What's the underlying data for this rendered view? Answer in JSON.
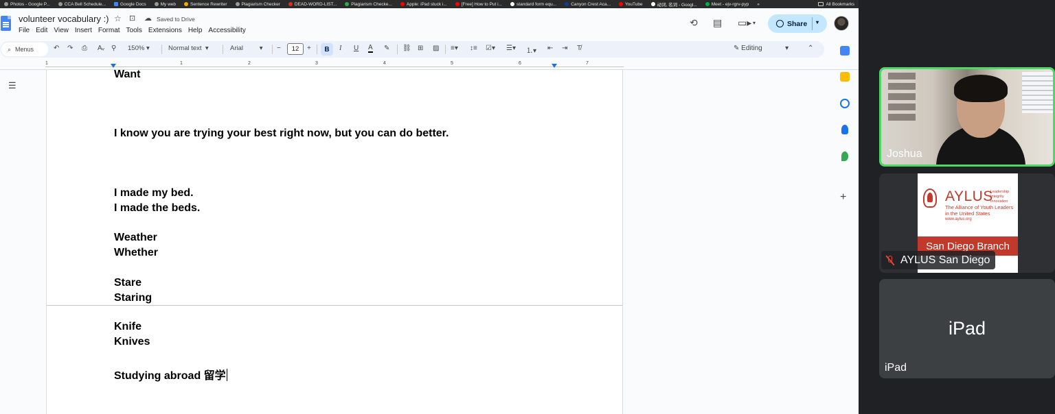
{
  "bookmarks": {
    "items": [
      "Photos - Google P...",
      "CCA Bell Schedule...",
      "Google Docs",
      "My web",
      "Sentence Rewriter",
      "Plagiarism Checker",
      "DEAD-WORD-LIST...",
      "Plagiarism Checke...",
      "Apple: iPad stuck i...",
      "[Free] How to Put i...",
      "standard form equ...",
      "Canyon Crest Aca...",
      "YouTube",
      "动词, 名词 - Googl...",
      "Meet - ejv-rgrv-pyp"
    ],
    "more": "»",
    "all_label": "All Bookmarks"
  },
  "doc": {
    "title": "volunteer vocabulary :)",
    "saved_status": "Saved to Drive",
    "menu": [
      "File",
      "Edit",
      "View",
      "Insert",
      "Format",
      "Tools",
      "Extensions",
      "Help",
      "Accessibility"
    ],
    "share_label": "Share"
  },
  "toolbar": {
    "menus_label": "Menus",
    "zoom": "150%",
    "style": "Normal text",
    "font": "Arial",
    "font_size": "12",
    "bold": "B",
    "italic": "I",
    "underline": "U",
    "text_color": "A",
    "mode": "Editing"
  },
  "ruler": {
    "numbers": [
      "1",
      "1",
      "2",
      "3",
      "4",
      "5",
      "6",
      "7"
    ]
  },
  "content": {
    "lines": [
      "Want",
      "I know you are trying your best right now, but you can do better.",
      "I made my bed.",
      "I made the beds.",
      "Weather",
      "Whether",
      "Stare",
      "Staring",
      "Knife",
      "Knives",
      "Studying abroad 留学"
    ]
  },
  "meet": {
    "participants": [
      {
        "name": "Joshua",
        "speaking": true
      },
      {
        "name": "AYLUS San Diego",
        "muted": true
      },
      {
        "name": "iPad"
      }
    ],
    "ipad_center": "iPad",
    "aylus_logo": {
      "word": "AYLUS",
      "tagline": "Leadership Integrity Innovation",
      "subtitle": "The Alliance of Youth Leaders in the United States",
      "url": "www.aylus.org",
      "branch": "San Diego Branch"
    }
  },
  "colors": {
    "speaking_border": "#4cd964",
    "share_bg": "#c2e7ff",
    "aylus_red": "#c0392b"
  }
}
